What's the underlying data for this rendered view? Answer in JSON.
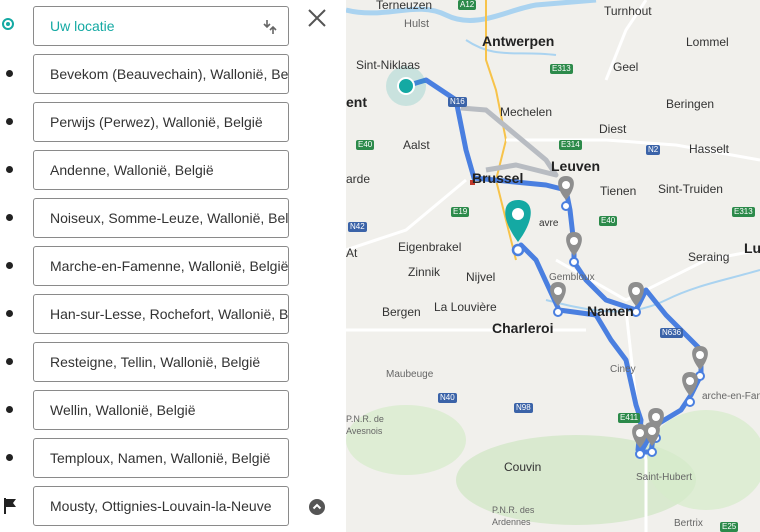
{
  "stops": [
    {
      "label": "Uw locatie",
      "kind": "current"
    },
    {
      "label": "Bevekom (Beauvechain), Wallonië, België",
      "kind": "via"
    },
    {
      "label": "Perwijs (Perwez), Wallonië, België",
      "kind": "via"
    },
    {
      "label": "Andenne, Wallonië, België",
      "kind": "via"
    },
    {
      "label": "Noiseux, Somme-Leuze, Wallonië, België",
      "kind": "via"
    },
    {
      "label": "Marche-en-Famenne, Wallonië, België",
      "kind": "via"
    },
    {
      "label": "Han-sur-Lesse, Rochefort, Wallonië, België",
      "kind": "via"
    },
    {
      "label": "Resteigne, Tellin, Wallonië, België",
      "kind": "via"
    },
    {
      "label": "Wellin, Wallonië, België",
      "kind": "via"
    },
    {
      "label": "Temploux, Namen, Wallonië, België",
      "kind": "via"
    },
    {
      "label": "Mousty, Ottignies-Louvain-la-Neuve",
      "kind": "destination"
    }
  ],
  "icons": {
    "current": "location-target-icon",
    "via": "waypoint-bullet-icon",
    "destination": "finish-flag-icon",
    "swap": "swap-arrows-icon",
    "close": "close-icon",
    "collapse": "chevron-up-icon"
  },
  "map": {
    "places": {
      "terneuzen": "Terneuzen",
      "hulst": "Hulst",
      "turnhout": "Turnhout",
      "antwerpen": "Antwerpen",
      "lommel": "Lommel",
      "sint_niklaas": "Sint-Niklaas",
      "geel": "Geel",
      "gent": "ent",
      "mechelen": "Mechelen",
      "beringen": "Beringen",
      "aalst": "Aalst",
      "diest": "Diest",
      "leuven": "Leuven",
      "hasselt": "Hasselt",
      "brussel": "Brussel",
      "tienen": "Tienen",
      "sint_truiden": "Sint-Truiden",
      "arde": "arde",
      "wavre": "avre",
      "eigenbrakel": "Eigenbrakel",
      "at": "At",
      "zinnik": "Zinnik",
      "nivel": "Nijvel",
      "gembloux": "Gembloux",
      "seraing": "Seraing",
      "luik": "Lui",
      "bergen": "Bergen",
      "la_louviere": "La Louvière",
      "namen": "Namen",
      "charleroi": "Charleroi",
      "maubeuge": "Maubeuge",
      "ciney": "Ciney",
      "marche": "arche-en-Fam",
      "pnr_avesnois": "P.N.R. de\nAvesnois",
      "couvin": "Couvin",
      "saint_hubert": "Saint-Hubert",
      "pnr_ardennes": "P.N.R. des\nArdennes",
      "bertrix": "Bertrix"
    },
    "roads": {
      "a12": "A12",
      "e313a": "E313",
      "n16": "N16",
      "e40a": "E40",
      "e314": "E314",
      "n2": "N2",
      "e40b": "E40",
      "e313b": "E313",
      "e19": "E19",
      "n42": "N42",
      "n636": "N636",
      "n40": "N40",
      "n98": "N98",
      "e411": "E411",
      "e25": "E25"
    },
    "colors": {
      "route": "#4a7fe0",
      "alt_route": "#b8bcc2",
      "start_marker": "#14a9a3",
      "waypoint_marker": "#8e8e8e",
      "water": "#aad3f0",
      "forest": "#cfe6c3"
    }
  }
}
